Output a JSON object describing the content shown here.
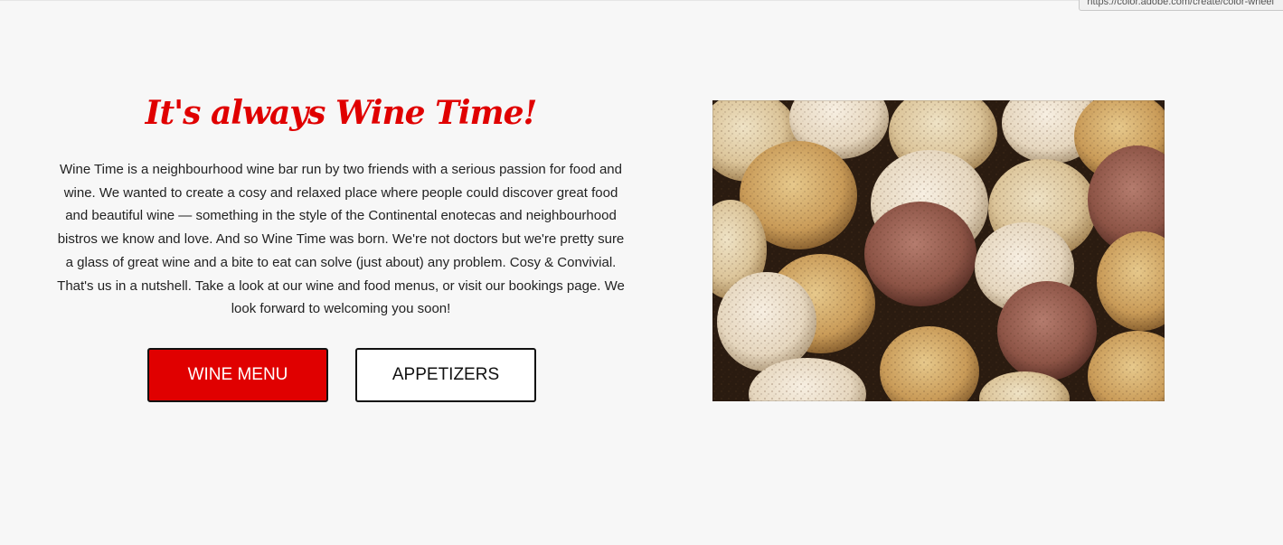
{
  "status_url": "https://color.adobe.com/create/color-wheel",
  "hero": {
    "title": "It's always Wine Time!",
    "description": "Wine Time is a neighbourhood wine bar run by two friends with a serious passion for food and wine. We wanted to create a cosy and relaxed place where people could discover great food and beautiful wine — something in the style of the Continental enotecas and neighbourhood bistros we know and love. And so Wine Time was born. We're not doctors but we're pretty sure a glass of great wine and a bite to eat can solve (just about) any problem. Cosy & Convivial. That's us in a nutshell. Take a look at our wine and food menus, or visit our bookings page. We look forward to welcoming you soon!",
    "buttons": {
      "wine_menu": "WINE MENU",
      "appetizers": "APPETIZERS"
    }
  },
  "colors": {
    "background": "#f7f7f7",
    "accent_red": "#e00000",
    "text": "#222222",
    "button_border": "#111111"
  },
  "icons": {
    "hero_image": "wine-corks-photo"
  }
}
